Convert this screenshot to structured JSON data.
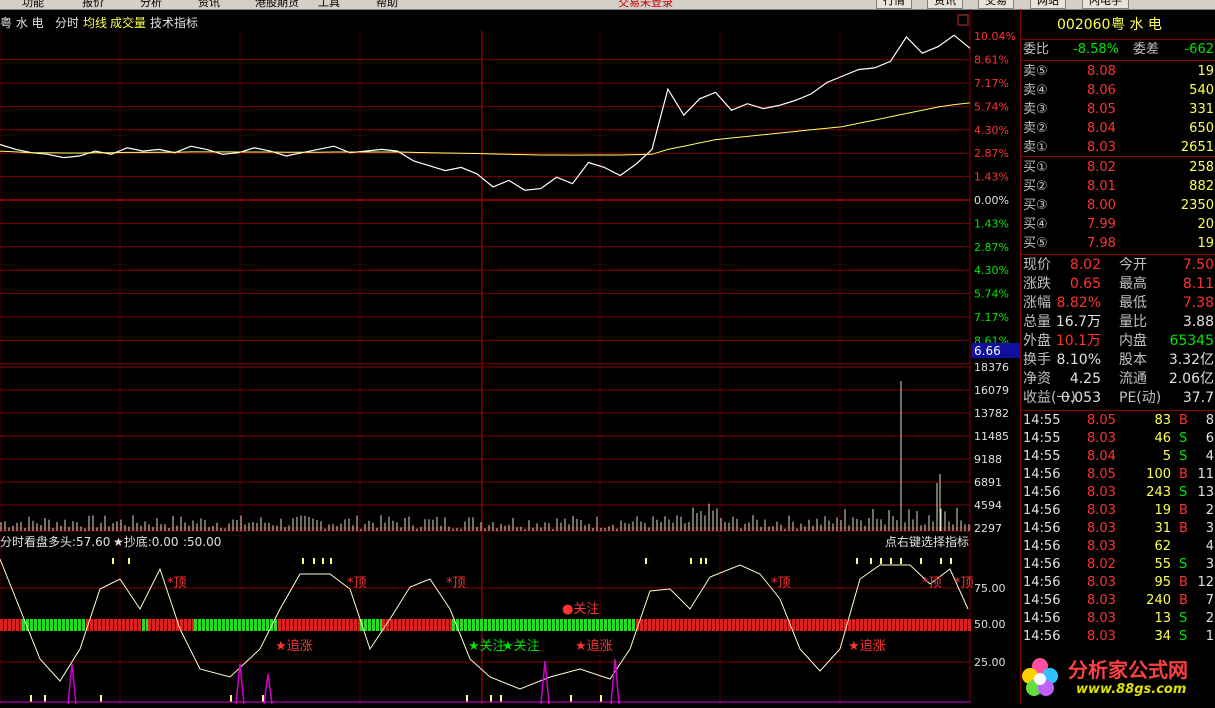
{
  "menu": {
    "items": [
      "功能",
      "报价",
      "分析",
      "资讯",
      "港股期货",
      "工具",
      "帮助"
    ],
    "center_title": "交易未登录",
    "buttons": [
      "行情",
      "资讯",
      "交易",
      "网站",
      "闪电手"
    ]
  },
  "header": {
    "stock_name": "粤 水 电",
    "tabs": [
      "分时",
      "均线",
      "成交量",
      "技术指标"
    ],
    "corner_icon": "square-icon"
  },
  "price_axis": {
    "up": [
      "10.04%",
      "8.61%",
      "7.17%",
      "5.74%",
      "4.30%",
      "2.87%",
      "1.43%"
    ],
    "zero": "0.00%",
    "down": [
      "1.43%",
      "2.87%",
      "4.30%",
      "5.74%",
      "7.17%",
      "8.61%"
    ],
    "current_label": "6.66"
  },
  "volume_axis": [
    "18376",
    "16079",
    "13782",
    "11485",
    "9188",
    "6891",
    "4594",
    "2297"
  ],
  "indicator": {
    "title": "分时看盘",
    "duotou": "多头:57.60",
    "chaodi": "★抄底:0.00",
    "extra": ":50.00",
    "hint": "点右键选择指标",
    "axis": [
      "75.00",
      "50.00",
      "25.00"
    ],
    "labels": {
      "top": "*顶",
      "chase": "★追涨",
      "watch_red": "●关注",
      "watch_green": "★关注"
    }
  },
  "chart_data": {
    "type": "line",
    "title": "",
    "xlabel": "",
    "ylabel": "",
    "ylim": [
      -10.04,
      10.04
    ],
    "series": [
      {
        "values": [
          3.4,
          3.1,
          2.9,
          2.8,
          2.6,
          2.7,
          3.0,
          2.8,
          3.2,
          3.0,
          3.1,
          2.9,
          3.3,
          3.1,
          2.8,
          2.9,
          3.2,
          3.0,
          2.7,
          2.9,
          3.1,
          3.3,
          2.9,
          3.0,
          3.1,
          3.0,
          2.4,
          2.1,
          1.8,
          2.0,
          1.6,
          0.8,
          1.2,
          0.6,
          0.7,
          1.4,
          1.0,
          2.3,
          2.0,
          1.5,
          2.2,
          3.1,
          6.8,
          5.2,
          6.2,
          6.6,
          5.5,
          5.9,
          5.6,
          5.8,
          6.1,
          6.5,
          7.2,
          7.6,
          8.0,
          8.1,
          8.5,
          10.0,
          9.0,
          9.4,
          10.1,
          9.3
        ]
      },
      {
        "values": [
          3.0,
          2.95,
          2.9,
          2.9,
          2.88,
          2.88,
          2.9,
          2.9,
          2.92,
          2.92,
          2.93,
          2.93,
          2.95,
          2.95,
          2.95,
          2.94,
          2.94,
          2.94,
          2.93,
          2.93,
          2.93,
          2.94,
          2.94,
          2.94,
          2.94,
          2.94,
          2.92,
          2.9,
          2.88,
          2.87,
          2.85,
          2.82,
          2.8,
          2.78,
          2.76,
          2.76,
          2.75,
          2.76,
          2.76,
          2.76,
          2.78,
          2.8,
          3.1,
          3.3,
          3.5,
          3.7,
          3.8,
          3.9,
          4.0,
          4.1,
          4.2,
          4.3,
          4.4,
          4.5,
          4.7,
          4.9,
          5.1,
          5.3,
          5.5,
          5.7,
          5.85,
          5.95
        ]
      }
    ]
  },
  "quote": {
    "code": "002060",
    "name": "粤 水 电",
    "weibi_label": "委比",
    "weibi": "-8.58%",
    "weicha_label": "委差",
    "weicha": "-662",
    "asks": [
      {
        "label": "卖⑤",
        "price": "8.08",
        "vol": "19"
      },
      {
        "label": "卖④",
        "price": "8.06",
        "vol": "540"
      },
      {
        "label": "卖③",
        "price": "8.05",
        "vol": "331"
      },
      {
        "label": "卖②",
        "price": "8.04",
        "vol": "650"
      },
      {
        "label": "卖①",
        "price": "8.03",
        "vol": "2651"
      }
    ],
    "bids": [
      {
        "label": "买①",
        "price": "8.02",
        "vol": "258"
      },
      {
        "label": "买②",
        "price": "8.01",
        "vol": "882"
      },
      {
        "label": "买③",
        "price": "8.00",
        "vol": "2350"
      },
      {
        "label": "买④",
        "price": "7.99",
        "vol": "20"
      },
      {
        "label": "买⑤",
        "price": "7.98",
        "vol": "19"
      }
    ],
    "stats": [
      {
        "l1": "现价",
        "v1": "8.02",
        "c1": "red",
        "l2": "今开",
        "v2": "7.50",
        "c2": "red"
      },
      {
        "l1": "涨跌",
        "v1": "0.65",
        "c1": "red",
        "l2": "最高",
        "v2": "8.11",
        "c2": "red"
      },
      {
        "l1": "涨幅",
        "v1": "8.82%",
        "c1": "red",
        "l2": "最低",
        "v2": "7.38",
        "c2": "red"
      },
      {
        "l1": "总量",
        "v1": "16.7万",
        "c1": "white",
        "l2": "量比",
        "v2": "3.88",
        "c2": "white"
      },
      {
        "l1": "外盘",
        "v1": "10.1万",
        "c1": "red",
        "l2": "内盘",
        "v2": "65345",
        "c2": "green"
      },
      {
        "l1": "换手",
        "v1": "8.10%",
        "c1": "white",
        "l2": "股本",
        "v2": "3.32亿",
        "c2": "white"
      },
      {
        "l1": "净资",
        "v1": "4.25",
        "c1": "white",
        "l2": "流通",
        "v2": "2.06亿",
        "c2": "white"
      },
      {
        "l1": "收益(一)",
        "v1": "0.053",
        "c1": "white",
        "l2": "PE(动)",
        "v2": "37.7",
        "c2": "white"
      }
    ],
    "ticks": [
      {
        "t": "14:55",
        "p": "8.05",
        "v": "83",
        "d": "B",
        "n": "8"
      },
      {
        "t": "14:55",
        "p": "8.03",
        "v": "46",
        "d": "S",
        "n": "6"
      },
      {
        "t": "14:55",
        "p": "8.04",
        "v": "5",
        "d": "S",
        "n": "4"
      },
      {
        "t": "14:56",
        "p": "8.05",
        "v": "100",
        "d": "B",
        "n": "11"
      },
      {
        "t": "14:56",
        "p": "8.03",
        "v": "243",
        "d": "S",
        "n": "13"
      },
      {
        "t": "14:56",
        "p": "8.03",
        "v": "19",
        "d": "B",
        "n": "2"
      },
      {
        "t": "14:56",
        "p": "8.03",
        "v": "31",
        "d": "B",
        "n": "3"
      },
      {
        "t": "14:56",
        "p": "8.03",
        "v": "62",
        "d": "",
        "n": "4"
      },
      {
        "t": "14:56",
        "p": "8.02",
        "v": "55",
        "d": "S",
        "n": "3"
      },
      {
        "t": "14:56",
        "p": "8.03",
        "v": "95",
        "d": "B",
        "n": "12"
      },
      {
        "t": "14:56",
        "p": "8.03",
        "v": "240",
        "d": "B",
        "n": "7"
      },
      {
        "t": "14:56",
        "p": "8.03",
        "v": "13",
        "d": "S",
        "n": "2"
      },
      {
        "t": "14:56",
        "p": "8.03",
        "v": "34",
        "d": "S",
        "n": "1"
      }
    ]
  },
  "logo": {
    "name": "分析家公式网",
    "url": "www.88gs.com"
  },
  "colors": {
    "grid": "#800000",
    "price_line": "#ffffff",
    "avg_line": "#ffff66",
    "up": "#ff3232",
    "down": "#00e600",
    "purple": "#d000d0"
  }
}
